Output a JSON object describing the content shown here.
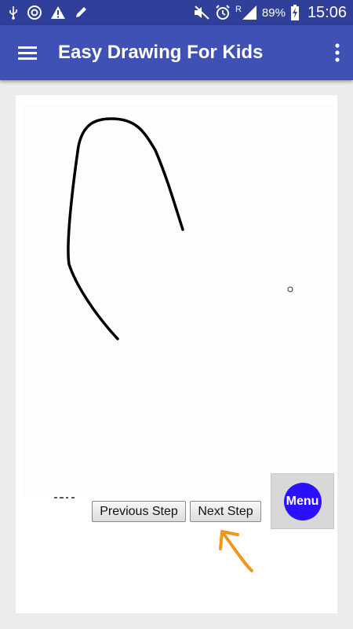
{
  "status_bar": {
    "battery": "89%",
    "time": "15:06",
    "network_label": "R",
    "icons": [
      "usb-icon",
      "sync-icon",
      "warning-icon",
      "pencil-icon",
      "mute-icon",
      "alarm-icon",
      "signal-icon",
      "battery-icon"
    ]
  },
  "app_bar": {
    "title": "Easy Drawing For Kids",
    "menu_icon": "hamburger-icon",
    "overflow_icon": "more-vert-icon"
  },
  "drawing": {
    "stroke_color": "#000000",
    "description_icon": "drawing-step-canvas"
  },
  "controls": {
    "previous_label": "Previous Step",
    "next_label": "Next Step",
    "menu_label": "Menu"
  },
  "colors": {
    "status_bar": "#2f3f9a",
    "app_bar": "#3f51b5",
    "menu_circle": "#2a10ff",
    "annotation_arrow": "#f0961a"
  }
}
